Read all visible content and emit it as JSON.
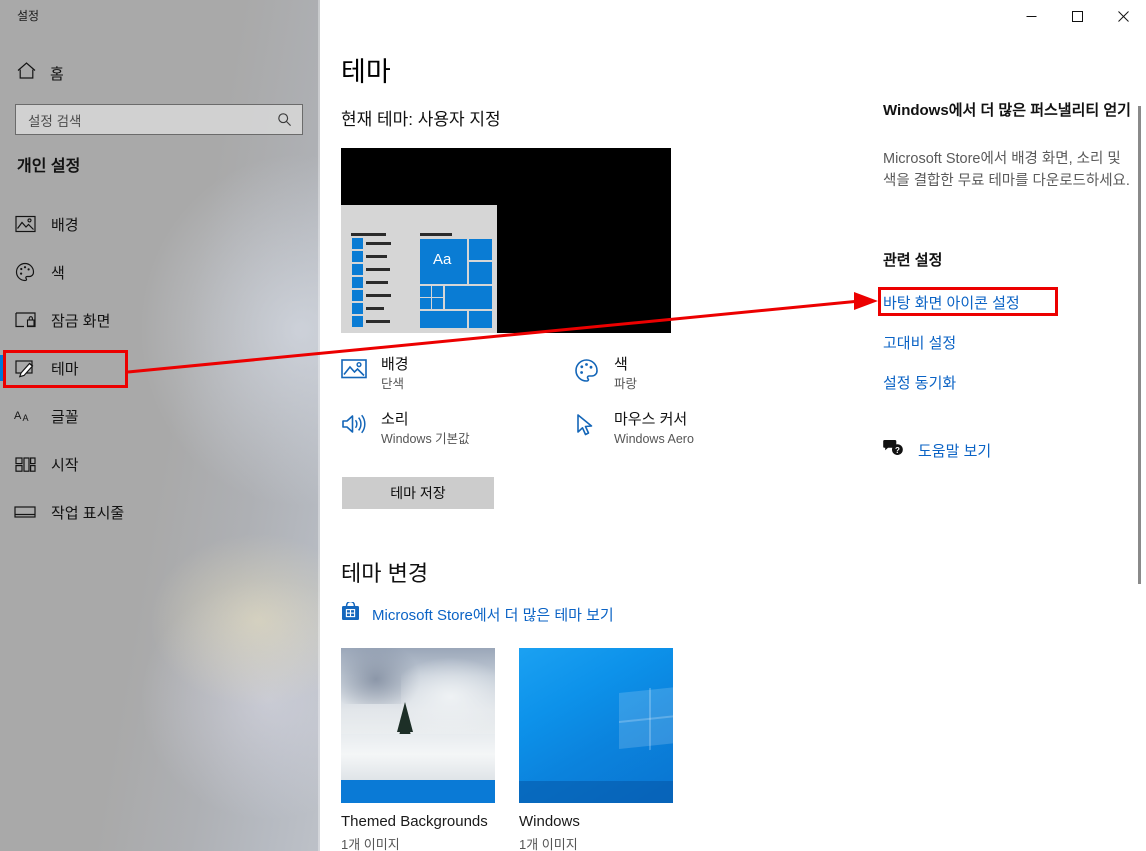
{
  "window": {
    "app_title": "설정",
    "controls": {
      "minimize": "minimize-icon",
      "maximize": "maximize-icon",
      "close": "close-icon"
    }
  },
  "sidebar": {
    "home_label": "홈",
    "home_icon": "home-icon",
    "search": {
      "placeholder": "설정 검색",
      "value": "",
      "icon": "search-icon"
    },
    "group_label": "개인 설정",
    "items": [
      {
        "label": "배경",
        "icon": "picture-icon",
        "selected": false
      },
      {
        "label": "색",
        "icon": "palette-icon",
        "selected": false
      },
      {
        "label": "잠금 화면",
        "icon": "lock-screen-icon",
        "selected": false
      },
      {
        "label": "테마",
        "icon": "theme-brush-icon",
        "selected": true
      },
      {
        "label": "글꼴",
        "icon": "font-icon",
        "selected": false
      },
      {
        "label": "시작",
        "icon": "start-icon",
        "selected": false
      },
      {
        "label": "작업 표시줄",
        "icon": "taskbar-icon",
        "selected": false
      }
    ]
  },
  "main": {
    "page_title": "테마",
    "current_theme": "현재 테마: 사용자 지정",
    "preview_alt": "theme-preview",
    "preview_sample_text": "Aa",
    "attributes": [
      {
        "name": "배경",
        "value": "단색",
        "icon": "picture-icon"
      },
      {
        "name": "색",
        "value": "파랑",
        "icon": "palette-icon"
      },
      {
        "name": "소리",
        "value": "Windows 기본값",
        "icon": "speaker-icon"
      },
      {
        "name": "마우스 커서",
        "value": "Windows Aero",
        "icon": "cursor-icon"
      }
    ],
    "save_button": "테마 저장",
    "change_theme_title": "테마 변경",
    "store_link": {
      "label": "Microsoft Store에서 더 많은 테마 보기",
      "icon": "microsoft-store-icon"
    },
    "themes": [
      {
        "name": "Themed Backgrounds",
        "count": "1개 이미지",
        "style": "winter"
      },
      {
        "name": "Windows",
        "count": "1개 이미지",
        "style": "windows"
      }
    ]
  },
  "rail": {
    "promo_heading": "Windows에서 더 많은 퍼스낼리티 얻기",
    "promo_body": "Microsoft Store에서 배경 화면, 소리 및 색을 결합한 무료 테마를 다운로드하세요.",
    "related_title": "관련 설정",
    "links": [
      {
        "label": "바탕 화면 아이콘 설정",
        "highlighted": true
      },
      {
        "label": "고대비 설정",
        "highlighted": false
      },
      {
        "label": "설정 동기화",
        "highlighted": false
      }
    ],
    "help": {
      "label": "도움말 보기",
      "icon": "help-question-icon"
    }
  },
  "annotations": {
    "color": "#ec0000",
    "boxes": [
      {
        "name": "highlight-theme-sidebar"
      },
      {
        "name": "highlight-desktop-icon-settings-link"
      }
    ],
    "arrow": {
      "name": "pointer-arrow"
    }
  }
}
